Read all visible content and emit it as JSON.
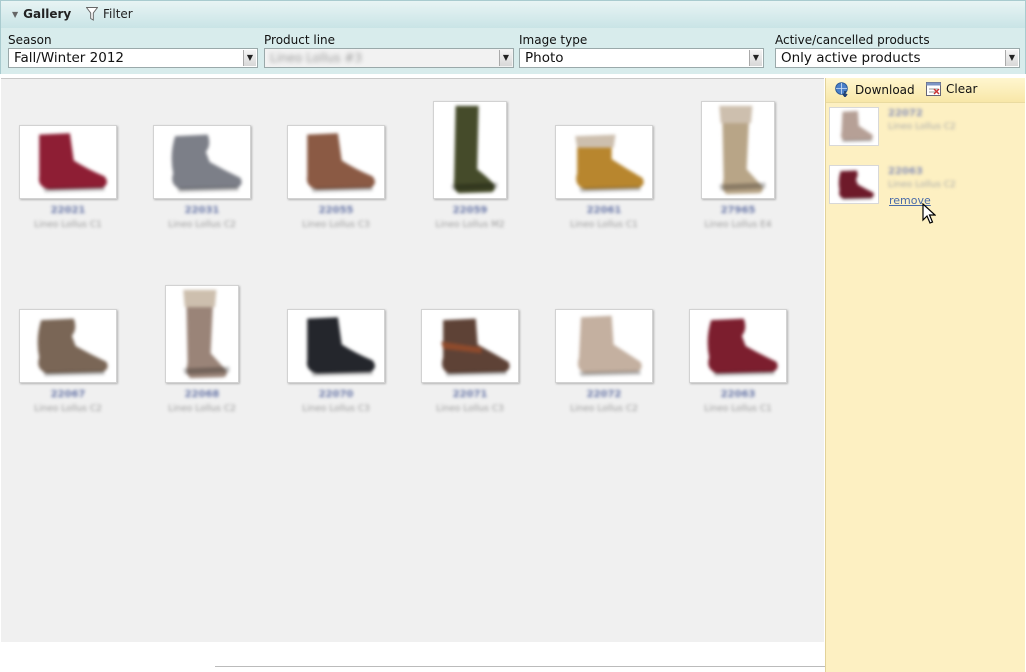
{
  "toolbar": {
    "gallery_label": "Gallery",
    "filter_label": "Filter"
  },
  "filters": [
    {
      "label": "Season",
      "value": "Fall/Winter 2012",
      "blurred": false
    },
    {
      "label": "Product line",
      "value": "Lineo Lollus #3",
      "blurred": true
    },
    {
      "label": "Image type",
      "value": "Photo",
      "blurred": false
    },
    {
      "label": "Active/cancelled products",
      "value": "Only active products",
      "blurred": false
    }
  ],
  "gallery": {
    "items": [
      {
        "code": "22021",
        "line": "Lineo Lollus C1",
        "color": "#8e1e34",
        "shape": "ankle-low"
      },
      {
        "code": "22031",
        "line": "Lineo Lollus C2",
        "color": "#7c7f88",
        "shape": "ankle-slouch"
      },
      {
        "code": "22055",
        "line": "Lineo Lollus C3",
        "color": "#8b5a44",
        "shape": "ankle-low"
      },
      {
        "code": "22059",
        "line": "Lineo Lollus M2",
        "color": "#454b2a",
        "shape": "tall"
      },
      {
        "code": "22061",
        "line": "Lineo Lollus C1",
        "color": "#b8862e",
        "shape": "ankle-fur"
      },
      {
        "code": "27965",
        "line": "Lineo Lollus E4",
        "color": "#b8a587",
        "shape": "tall-fur"
      },
      {
        "code": "22067",
        "line": "Lineo Lollus C2",
        "color": "#7a6656",
        "shape": "ankle-slouch"
      },
      {
        "code": "22068",
        "line": "Lineo Lollus C2",
        "color": "#9a8478",
        "shape": "tall-fur"
      },
      {
        "code": "22070",
        "line": "Lineo Lollus C3",
        "color": "#24262c",
        "shape": "ankle-low"
      },
      {
        "code": "22071",
        "line": "Lineo Lollus C3",
        "color": "#5e4236",
        "shape": "ankle-strap"
      },
      {
        "code": "22072",
        "line": "Lineo Lollus C2",
        "color": "#c4b0a0",
        "shape": "ankle-lace"
      },
      {
        "code": "22063",
        "line": "Lineo Lollus C1",
        "color": "#7c1e2e",
        "shape": "ankle-slouch"
      }
    ]
  },
  "panel": {
    "download_label": "Download",
    "clear_label": "Clear",
    "items": [
      {
        "code": "22072",
        "line": "Lineo Lollus C2",
        "color": "#b6a096",
        "shape": "ankle-lace"
      },
      {
        "code": "22063",
        "line": "Lineo Lollus C2",
        "color": "#6e1a2a",
        "shape": "ankle-slouch",
        "remove_label": "remove"
      }
    ]
  }
}
